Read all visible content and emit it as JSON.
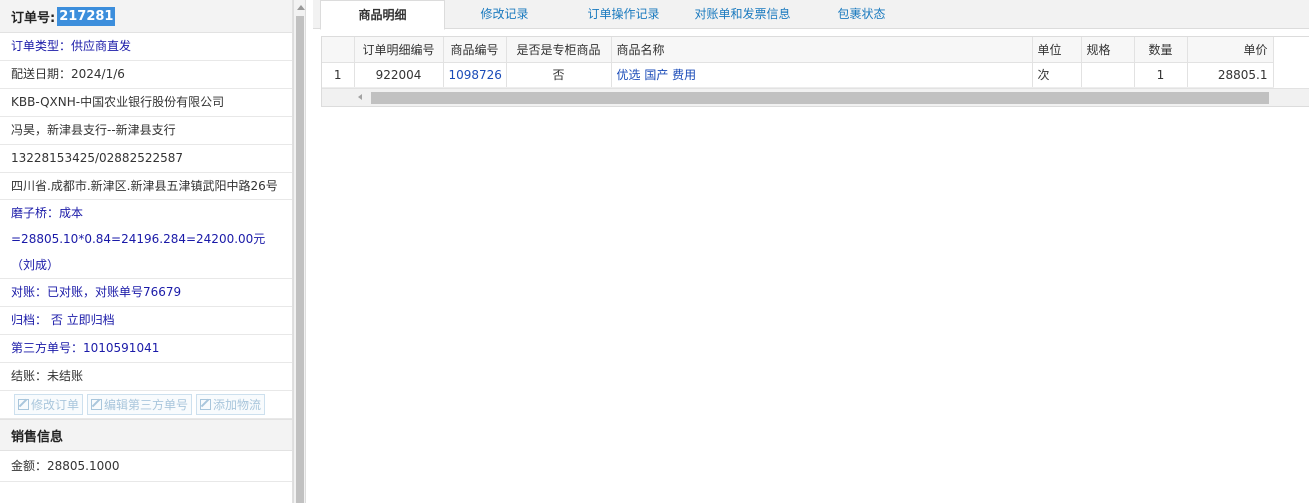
{
  "order": {
    "label": "订单号:",
    "number": "217281"
  },
  "info_rows": {
    "order_type": "订单类型：供应商直发",
    "delivery_date": "配送日期：2024/1/6",
    "company": "KBB-QXNH-中国农业银行股份有限公司",
    "contact": "冯昊，新津县支行--新津县支行",
    "phone": "13228153425/02882522587",
    "address": "四川省.成都市.新津区.新津县五津镇武阳中路26号",
    "cost": "磨子桥：成本=28805.10*0.84=24196.284=24200.00元（刘成）",
    "reconcile": "对账：已对账，对账单号76679",
    "archive": "归档： 否 立即归档",
    "third_party": "第三方单号：1010591041",
    "settle": "结账：未结账"
  },
  "buttons": {
    "edit_order": "修改订单",
    "edit_third": "编辑第三方单号",
    "add_logistics": "添加物流"
  },
  "sales": {
    "title": "销售信息",
    "amount": "金额：28805.1000"
  },
  "tabs": [
    {
      "label": "商品明细",
      "active": true
    },
    {
      "label": "修改记录",
      "active": false
    },
    {
      "label": "订单操作记录",
      "active": false
    },
    {
      "label": "对账单和发票信息",
      "active": false
    },
    {
      "label": "包裹状态",
      "active": false
    }
  ],
  "table": {
    "columns": [
      "",
      "订单明细编号",
      "商品编号",
      "是否是专柜商品",
      "商品名称",
      "单位",
      "规格",
      "数量",
      "单价"
    ],
    "rows": [
      {
        "idx": "1",
        "detail_no": "922004",
        "product_no": "1098726",
        "is_counter": "否",
        "name": "优选 国产 费用",
        "unit": "次",
        "spec": "",
        "qty": "1",
        "price": "28805.1"
      }
    ]
  },
  "colors": {
    "accent_blue": "#1a7abf",
    "link_blue": "#1a4bb8",
    "info_blue": "#1a1aa8",
    "selection": "#3c8edc"
  }
}
